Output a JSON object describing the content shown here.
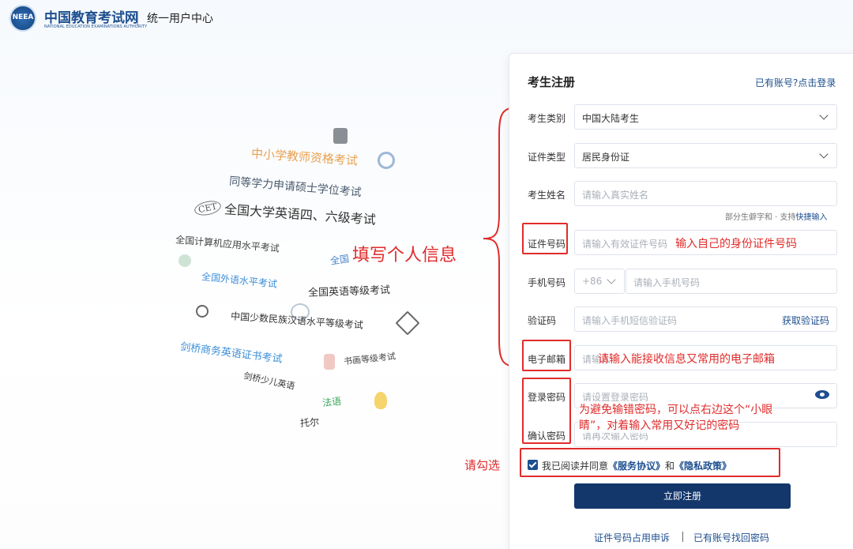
{
  "header": {
    "logo_text": "NEEA",
    "site_name": "中国教育考试网",
    "site_name_en": "NATIONAL EDUCATION EXAMINATIONS AUTHORITY",
    "center_title": "统一用户中心"
  },
  "word_cloud": [
    "中小学教师资格考试",
    "同等学力申请硕士学位考试",
    "CET",
    "全国大学英语四、六级考试",
    "全国计算机应用水平考试",
    "全国",
    "全国外语水平考试",
    "全国英语等级考试",
    "中国少数民族汉语水平等级考试",
    "剑桥商务英语证书考试",
    "书画等级考试",
    "剑桥少儿英语",
    "法语",
    "托尔"
  ],
  "form": {
    "title": "考生注册",
    "login_link": "已有账号?点击登录",
    "category_label": "考生类别",
    "category_value": "中国大陆考生",
    "idtype_label": "证件类型",
    "idtype_value": "居民身份证",
    "name_label": "考生姓名",
    "name_placeholder": "请输入真实姓名",
    "rare_hint": "部分生僻字和 · 支持",
    "rare_hint_link": "快捷输入",
    "idno_label": "证件号码",
    "idno_placeholder": "请输入有效证件号码",
    "phone_label": "手机号码",
    "phone_code": "+86",
    "phone_placeholder": "请输入手机号码",
    "code_label": "验证码",
    "code_placeholder": "请输入手机短信验证码",
    "get_code": "获取验证码",
    "email_label": "电子邮箱",
    "email_placeholder": "请输入",
    "pwd_label": "登录密码",
    "pwd_placeholder": "请设置登录密码",
    "pwd2_label": "确认密码",
    "pwd2_placeholder": "请再次输入密码",
    "agree_prefix": "我已阅读并同意",
    "agree_service": "《服务协议》",
    "agree_and": "和",
    "agree_privacy": "《隐私政策》",
    "submit": "立即注册",
    "footer_appeal": "证件号码占用申诉",
    "footer_recover": "已有账号找回密码"
  },
  "annotations": {
    "personal_info": "填写个人信息",
    "id_note": "输入自己的身份证件号码",
    "email_note": "请输入能接收信息又常用的电子邮箱",
    "pwd_note_1": "为避免输错密码，可以点右边这个“小眼",
    "pwd_note_2": "睛”，对着输入常用又好记的密码",
    "check_note": "请勾选"
  },
  "colors": {
    "brand": "#1d4f8f",
    "button": "#13376b",
    "annotation": "#e12b2b"
  }
}
